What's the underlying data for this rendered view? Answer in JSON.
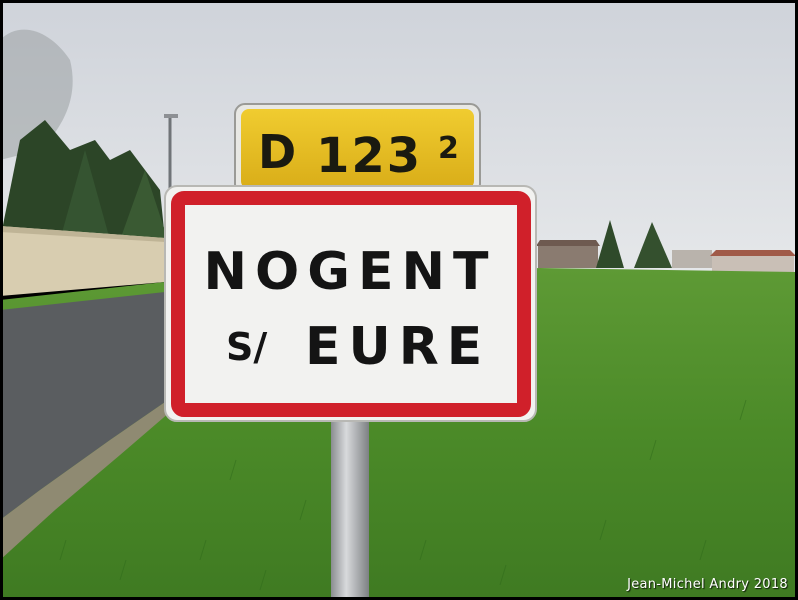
{
  "photo": {
    "description_colors": {
      "sky": "#dcdfe4",
      "grass": "#4f8a2a",
      "road": "#5a5d60",
      "wall": "#d8cdb0",
      "sign_border": "#d0202a",
      "plate_yellow": "#e8c020"
    }
  },
  "route_plate": {
    "letter": "D",
    "number": "123",
    "superscript": "2"
  },
  "town_sign": {
    "line1": "NOGENT",
    "line2_prefix": "S/",
    "line2_name": "EURE"
  },
  "credit": {
    "text": "Jean-Michel Andry 2018"
  }
}
